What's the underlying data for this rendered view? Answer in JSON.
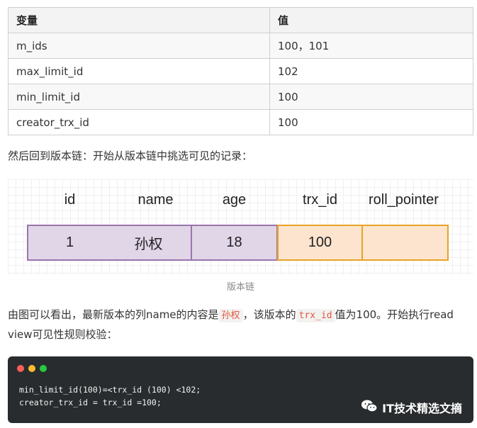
{
  "variables_table": {
    "headers": [
      "变量",
      "值"
    ],
    "rows": [
      [
        "m_ids",
        "100，101"
      ],
      [
        "max_limit_id",
        "102"
      ],
      [
        "min_limit_id",
        "100"
      ],
      [
        "creator_trx_id",
        "100"
      ]
    ]
  },
  "intro_text": "然后回到版本链：开始从版本链中挑选可见的记录：",
  "version_chain": {
    "columns": [
      "id",
      "name",
      "age",
      "trx_id",
      "roll_pointer"
    ],
    "values": [
      "1",
      "孙权",
      "18",
      "100",
      ""
    ],
    "caption": "版本链",
    "colors": {
      "purple_fill": "#e1d5e8",
      "purple_border": "#9a75ab",
      "orange_fill": "#fde4ce",
      "orange_border": "#e7a427"
    }
  },
  "explain": {
    "part1": "由图可以看出，最新版本的列name的内容是",
    "code1": "孙权",
    "part2": "，该版本的",
    "code2": "trx_id",
    "part3": "值为100。开始执行read view可见性规则校验："
  },
  "code_block": {
    "lines": [
      "min_limit_id(100)=<trx_id (100) <102;",
      "creator_trx_id = trx_id =100;"
    ],
    "dot_colors": [
      "#fc5f57",
      "#fdbc2e",
      "#28c840"
    ]
  },
  "watermark": {
    "text": "IT技术精选文摘",
    "icon": "wechat-icon"
  }
}
